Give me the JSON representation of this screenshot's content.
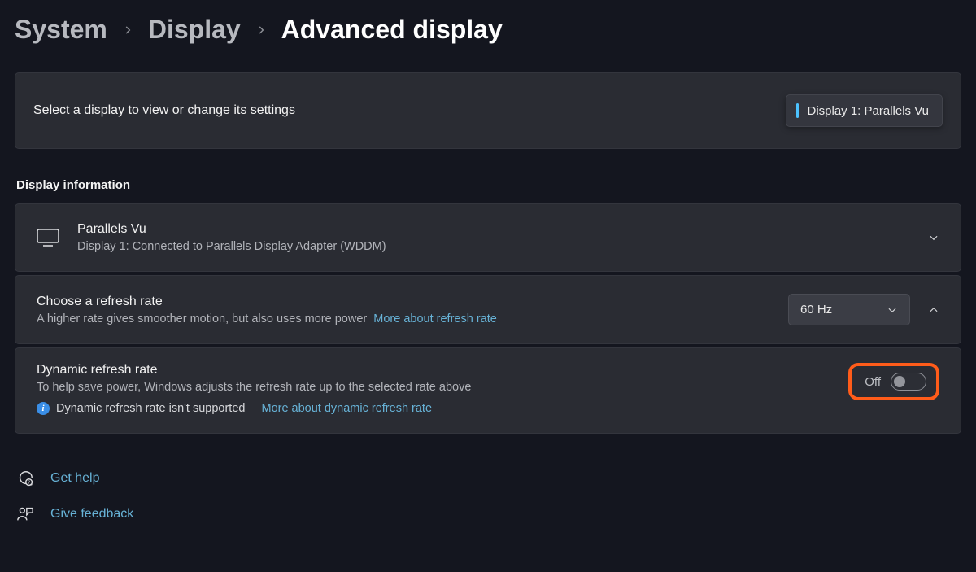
{
  "breadcrumb": {
    "system": "System",
    "display": "Display",
    "current": "Advanced display"
  },
  "selectCard": {
    "label": "Select a display to view or change its settings",
    "selected": "Display 1: Parallels Vu"
  },
  "sectionLabel": "Display information",
  "infoCard": {
    "title": "Parallels Vu",
    "sub": "Display 1: Connected to Parallels Display Adapter (WDDM)"
  },
  "refreshCard": {
    "title": "Choose a refresh rate",
    "sub": "A higher rate gives smoother motion, but also uses more power",
    "link": "More about refresh rate",
    "value": "60 Hz"
  },
  "drrCard": {
    "title": "Dynamic refresh rate",
    "sub": "To help save power, Windows adjusts the refresh rate up to the selected rate above",
    "infoText": "Dynamic refresh rate isn't supported",
    "infoLink": "More about dynamic refresh rate",
    "toggleLabel": "Off"
  },
  "footer": {
    "help": "Get help",
    "feedback": "Give feedback"
  }
}
